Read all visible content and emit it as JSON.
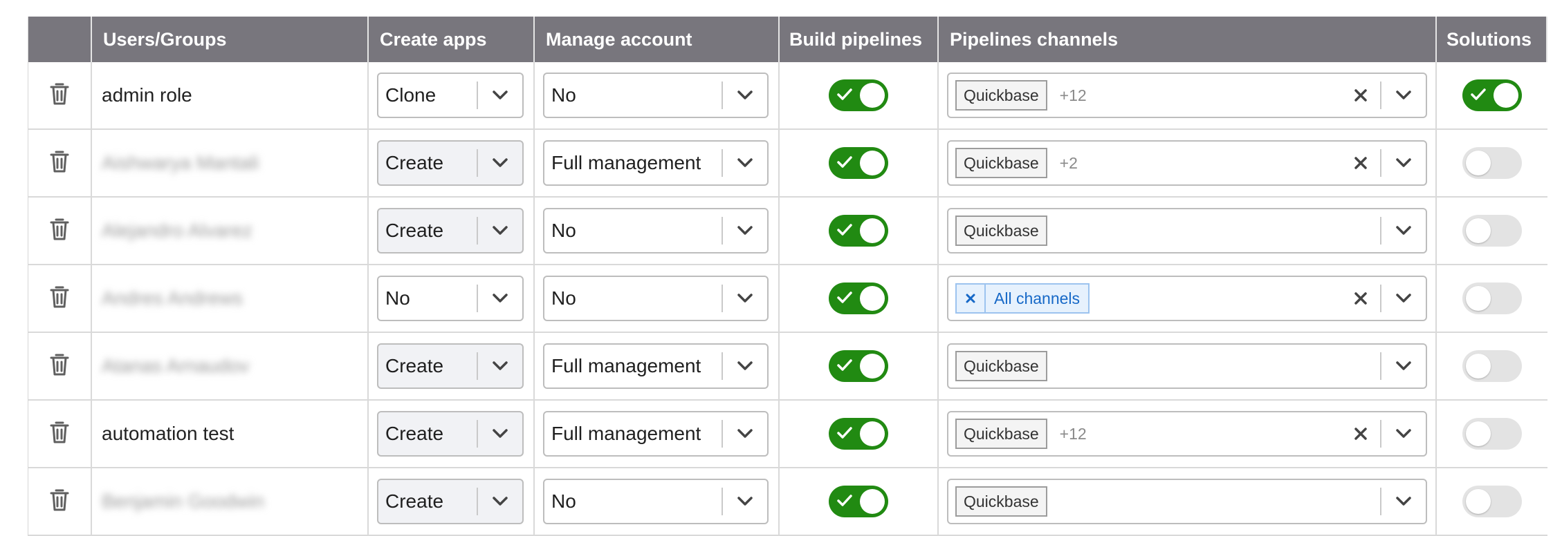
{
  "headers": [
    "",
    "Users/Groups",
    "Create apps",
    "Manage account",
    "Build pipelines",
    "Pipelines channels",
    "Solutions"
  ],
  "colors": {
    "header_bg": "#78767d",
    "toggle_on": "#218a12",
    "toggle_off": "#e3e3e3",
    "chip_blue": "#1668c7"
  },
  "icons": {
    "delete": "trash-icon",
    "dropdown": "chevron-down-icon",
    "clear": "close-icon",
    "toggle_on": "check-icon"
  },
  "rows": [
    {
      "name": "admin role",
      "blurred": false,
      "create_apps": "Clone",
      "manage_account": "No",
      "build_pipelines": true,
      "channel_chip": "Quickbase",
      "channel_more": "+12",
      "channel_all": false,
      "clearable": true,
      "solutions": true
    },
    {
      "name": "Aishwarya Mantali",
      "blurred": true,
      "create_apps": "Create",
      "manage_account": "Full management",
      "build_pipelines": true,
      "channel_chip": "Quickbase",
      "channel_more": "+2",
      "channel_all": false,
      "clearable": true,
      "solutions": false
    },
    {
      "name": "Alejandro Alvarez",
      "blurred": true,
      "create_apps": "Create",
      "manage_account": "No",
      "build_pipelines": true,
      "channel_chip": "Quickbase",
      "channel_more": "",
      "channel_all": false,
      "clearable": false,
      "solutions": false
    },
    {
      "name": "Andres Andrews",
      "blurred": true,
      "create_apps": "No",
      "manage_account": "No",
      "build_pipelines": true,
      "channel_chip": "All channels",
      "channel_more": "",
      "channel_all": true,
      "clearable": true,
      "solutions": false
    },
    {
      "name": "Atanas Arnaudov",
      "blurred": true,
      "create_apps": "Create",
      "manage_account": "Full management",
      "build_pipelines": true,
      "channel_chip": "Quickbase",
      "channel_more": "",
      "channel_all": false,
      "clearable": false,
      "solutions": false
    },
    {
      "name": "automation test",
      "blurred": false,
      "create_apps": "Create",
      "manage_account": "Full management",
      "build_pipelines": true,
      "channel_chip": "Quickbase",
      "channel_more": "+12",
      "channel_all": false,
      "clearable": true,
      "solutions": false
    },
    {
      "name": "Benjamin Goodwin",
      "blurred": true,
      "create_apps": "Create",
      "manage_account": "No",
      "build_pipelines": true,
      "channel_chip": "Quickbase",
      "channel_more": "",
      "channel_all": false,
      "clearable": false,
      "solutions": false
    }
  ]
}
